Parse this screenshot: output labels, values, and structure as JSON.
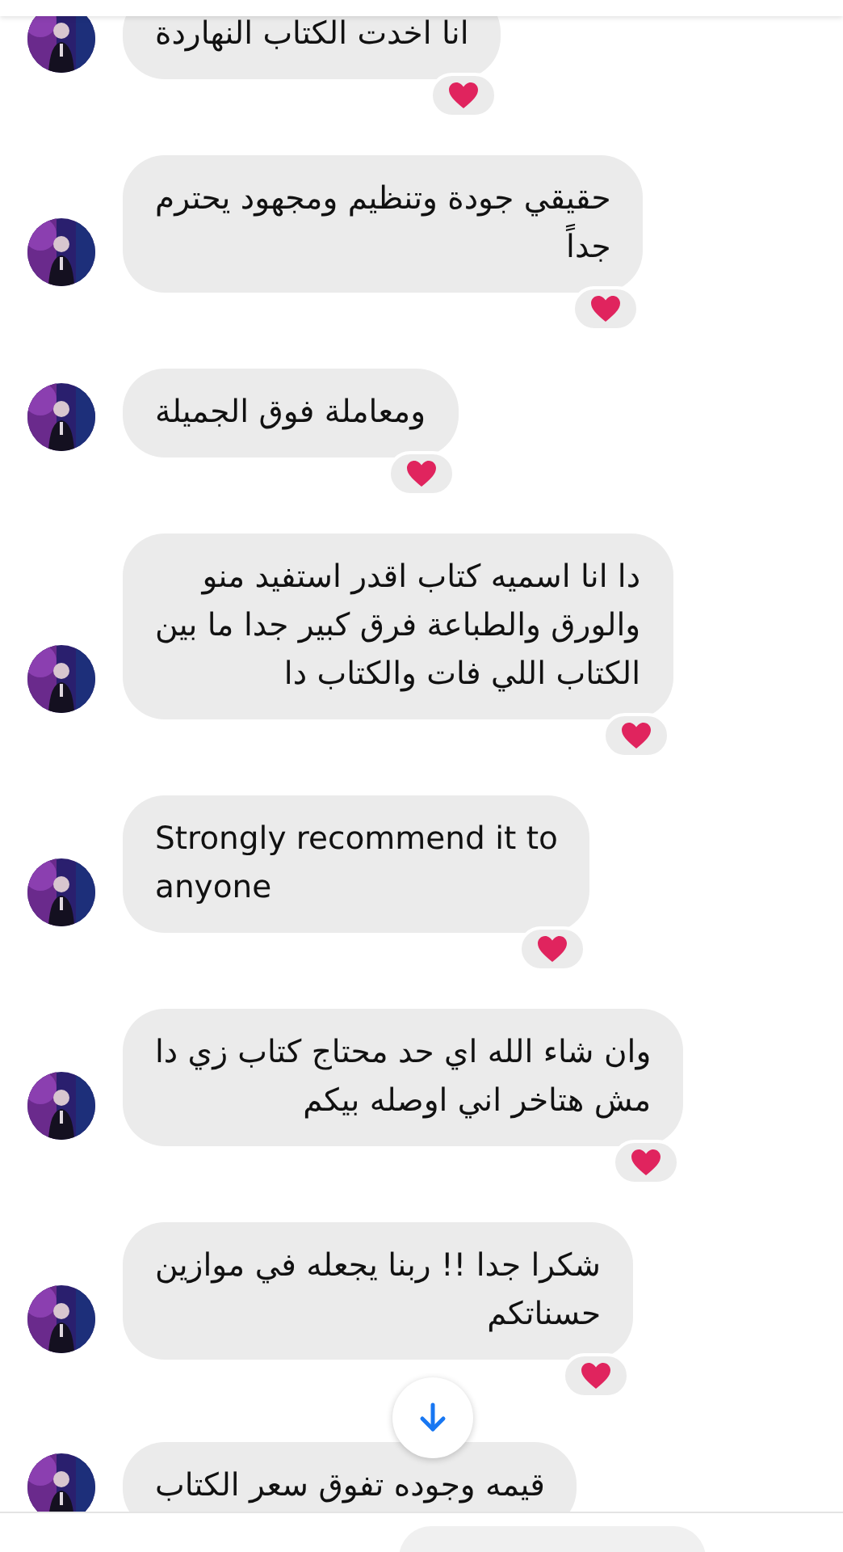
{
  "messages": [
    {
      "text": "انا اخدت الكتاب النهاردة",
      "reacted": true
    },
    {
      "text": "حقيقي جودة وتنظيم ومجهود يحترم\nجداً",
      "reacted": true
    },
    {
      "text": "ومعاملة فوق الجميلة",
      "reacted": true
    },
    {
      "text": "دا انا اسميه كتاب اقدر استفيد منو\nوالورق والطباعة فرق كبير جدا ما بين\nالكتاب اللي فات والكتاب دا",
      "reacted": true
    },
    {
      "text": "Strongly recommend it to\nanyone",
      "reacted": true
    },
    {
      "text": "وان شاء الله اي حد محتاج كتاب زي دا\nمش هتاخر اني اوصله بيكم",
      "reacted": true
    },
    {
      "text": "شكرا جدا !! ربنا يجعله في موازين\nحسناتكم",
      "reacted": true
    },
    {
      "text": "قيمه وجوده تفوق سعر الكتاب",
      "reacted": false
    }
  ]
}
